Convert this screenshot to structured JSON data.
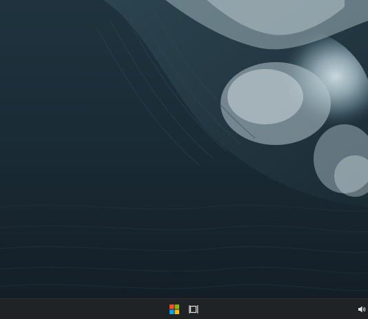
{
  "desktop": {
    "wallpaper": "ocean-wave"
  },
  "taskbar": {
    "start_icon": "windows-logo",
    "task_view_icon": "task-view",
    "tray": {
      "volume_icon": "speaker"
    },
    "colors": {
      "background": "#202326",
      "start_red": "#f25022",
      "start_green": "#7fba00",
      "start_blue": "#00a4ef",
      "start_yellow": "#ffb900"
    }
  }
}
